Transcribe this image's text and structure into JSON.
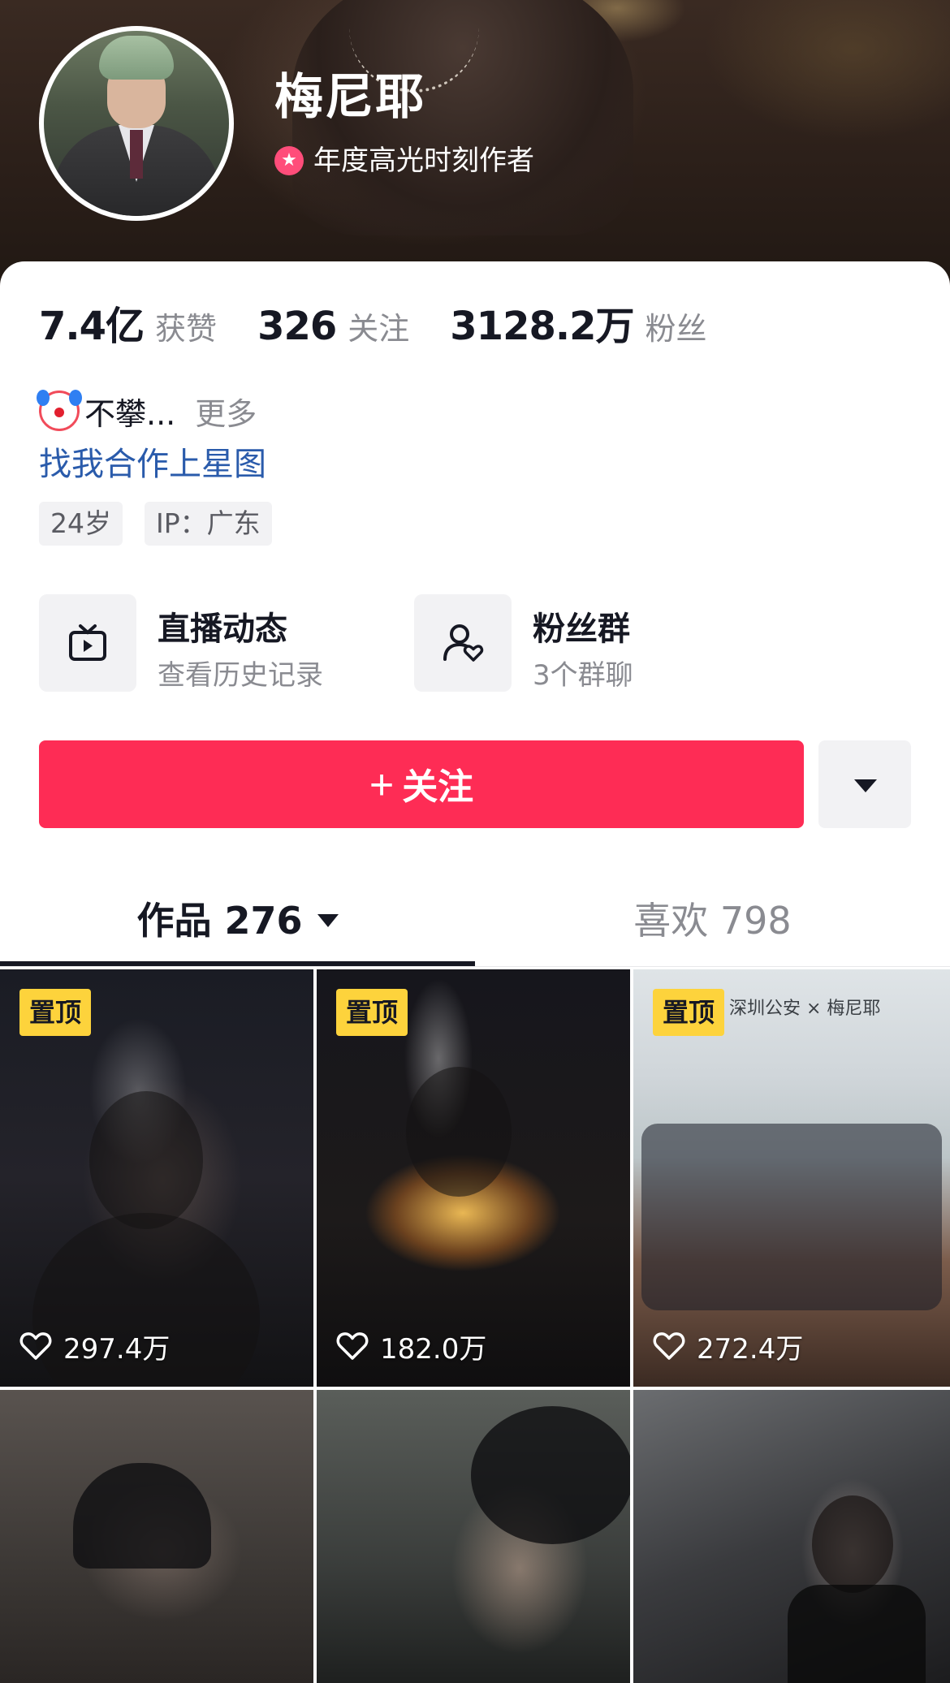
{
  "profile": {
    "name": "梅尼耶",
    "honor": "年度高光时刻作者"
  },
  "stats": [
    {
      "value": "7.4亿",
      "label": "获赞"
    },
    {
      "value": "326",
      "label": "关注"
    },
    {
      "value": "3128.2万",
      "label": "粉丝"
    }
  ],
  "bio": {
    "text": "不攀...",
    "more": "更多",
    "link": "找我合作上星图"
  },
  "tags": [
    "24岁",
    "IP：广东"
  ],
  "features": {
    "live": {
      "title": "直播动态",
      "subtitle": "查看历史记录",
      "icon": "tv-icon"
    },
    "fans": {
      "title": "粉丝群",
      "subtitle": "3个群聊",
      "icon": "user-heart-icon"
    }
  },
  "actions": {
    "follow_label": "关注",
    "more_icon": "caret-down-icon",
    "accent": "#fe2c55"
  },
  "tabs": {
    "works_label": "作品 276",
    "likes_label": "喜欢 798"
  },
  "videos": [
    {
      "pinned": true,
      "likes": "297.4万"
    },
    {
      "pinned": true,
      "likes": "182.0万"
    },
    {
      "pinned": true,
      "likes": "272.4万",
      "caption": "深圳公安 × 梅尼耶"
    },
    {
      "pinned": false
    },
    {
      "pinned": false
    },
    {
      "pinned": false
    }
  ],
  "pin_label": "置顶"
}
